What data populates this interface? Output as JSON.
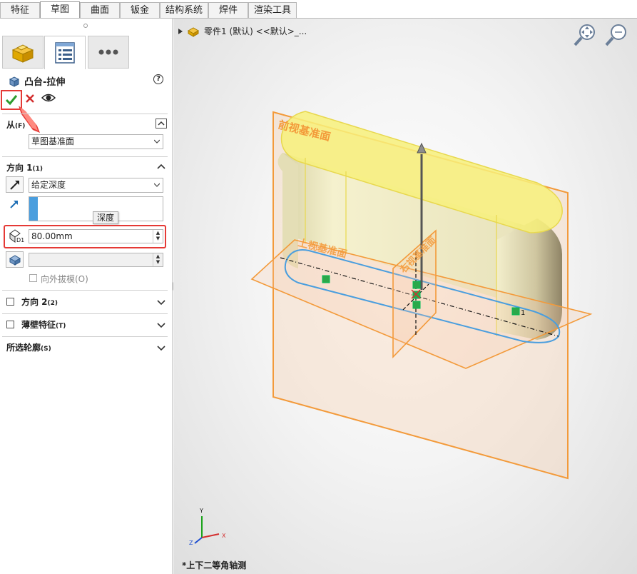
{
  "tabs": [
    "特征",
    "草图",
    "曲面",
    "钣金",
    "结构系统",
    "焊件",
    "渲染工具"
  ],
  "active_tab": "草图",
  "panel": {
    "title": "凸台-拉伸",
    "help": "?",
    "from_section": {
      "label": "从",
      "shortcut": "(F)",
      "value": "草图基准面"
    },
    "direction1": {
      "label": "方向 1",
      "shortcut": "(1)",
      "end_condition": "给定深度",
      "depth_value": "80.00mm",
      "depth_tooltip": "深度",
      "draft_outward": "向外拔模(O)"
    },
    "direction2": {
      "label": "方向 2",
      "shortcut": "(2)"
    },
    "thin_feature": {
      "label": "薄壁特征",
      "shortcut": "(T)"
    },
    "selected_contours": {
      "label": "所选轮廓",
      "shortcut": "(S)"
    }
  },
  "viewport": {
    "breadcrumb": "零件1 (默认) <<默认>_...",
    "view_name": "*上下二等角轴测",
    "planes": {
      "front": "前视基准面",
      "top": "上视基准面",
      "right": "右视基准面"
    },
    "dim_label": "1",
    "triad": {
      "x": "X",
      "y": "Y",
      "z": "Z"
    }
  },
  "colors": {
    "accent": "#e53935",
    "plane_orange": "#f39a3a",
    "extrude_yellow": "#f7f07a",
    "sketch_blue": "#4a9ede"
  }
}
